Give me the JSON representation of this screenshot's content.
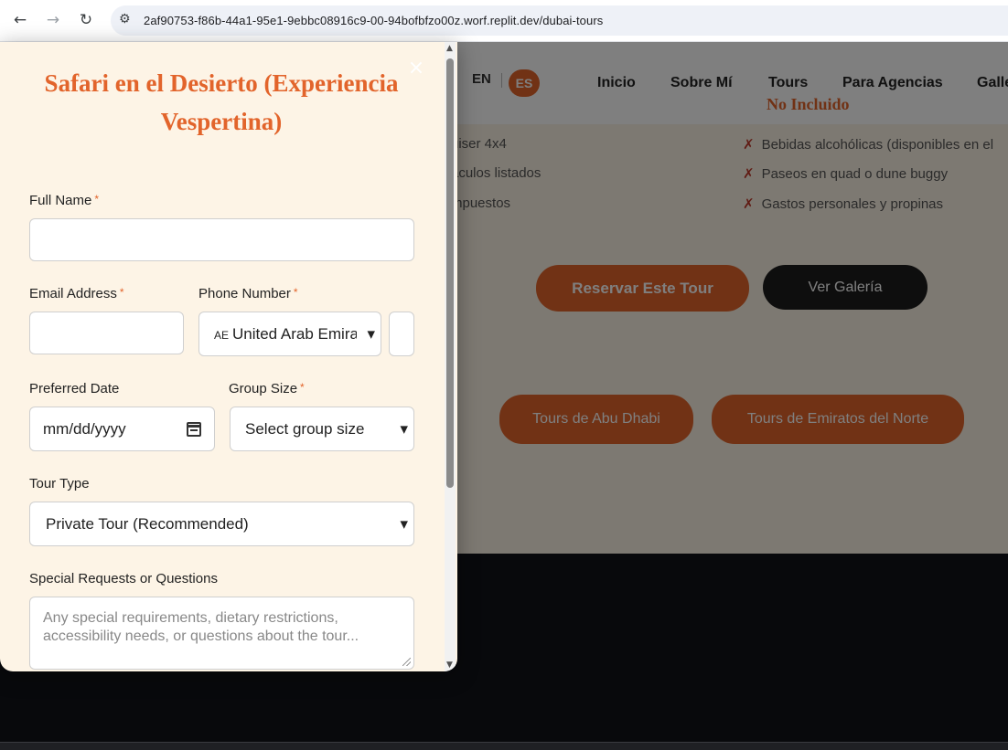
{
  "browser": {
    "url": "2af90753-f86b-44a1-95e1-9ebbc08916c9-00-94bofbfzo00z.worf.replit.dev/dubai-tours"
  },
  "site": {
    "lang_en": "EN",
    "lang_es": "ES",
    "menu": [
      "Inicio",
      "Sobre Mí",
      "Tours",
      "Para Agencias",
      "Galle"
    ],
    "peek_heading": "No Incluido",
    "included": [
      "uiser 4x4",
      "áculos listados",
      "mpuestos"
    ],
    "excluded": [
      "Bebidas alcohólicas (disponibles en el",
      "Paseos en quad o dune buggy",
      "Gastos personales y propinas"
    ],
    "book_button": "Reservar Este Tour",
    "gallery_button": "Ver Galería",
    "abu_dhabi_button": "Tours de Abu Dhabi",
    "north_button": "Tours de Emiratos del Norte",
    "accent_color": "#e2642b"
  },
  "modal": {
    "title": "Safari en el Desierto (Experiencia Vespertina)",
    "close_icon": "×",
    "required_marker": "*",
    "full_name_label": "Full Name",
    "email_label": "Email Address",
    "phone_label": "Phone Number",
    "country_value": "United Arab Emira",
    "country_flag": "AE",
    "date_label": "Preferred Date",
    "date_value": "mm/dd/yyyy",
    "group_label": "Group Size",
    "group_value": "Select group size",
    "tour_type_label": "Tour Type",
    "tour_type_value": "Private Tour (Recommended)",
    "requests_label": "Special Requests or Questions",
    "requests_placeholder": "Any special requirements, dietary restrictions, accessibility needs, or questions about the tour..."
  }
}
